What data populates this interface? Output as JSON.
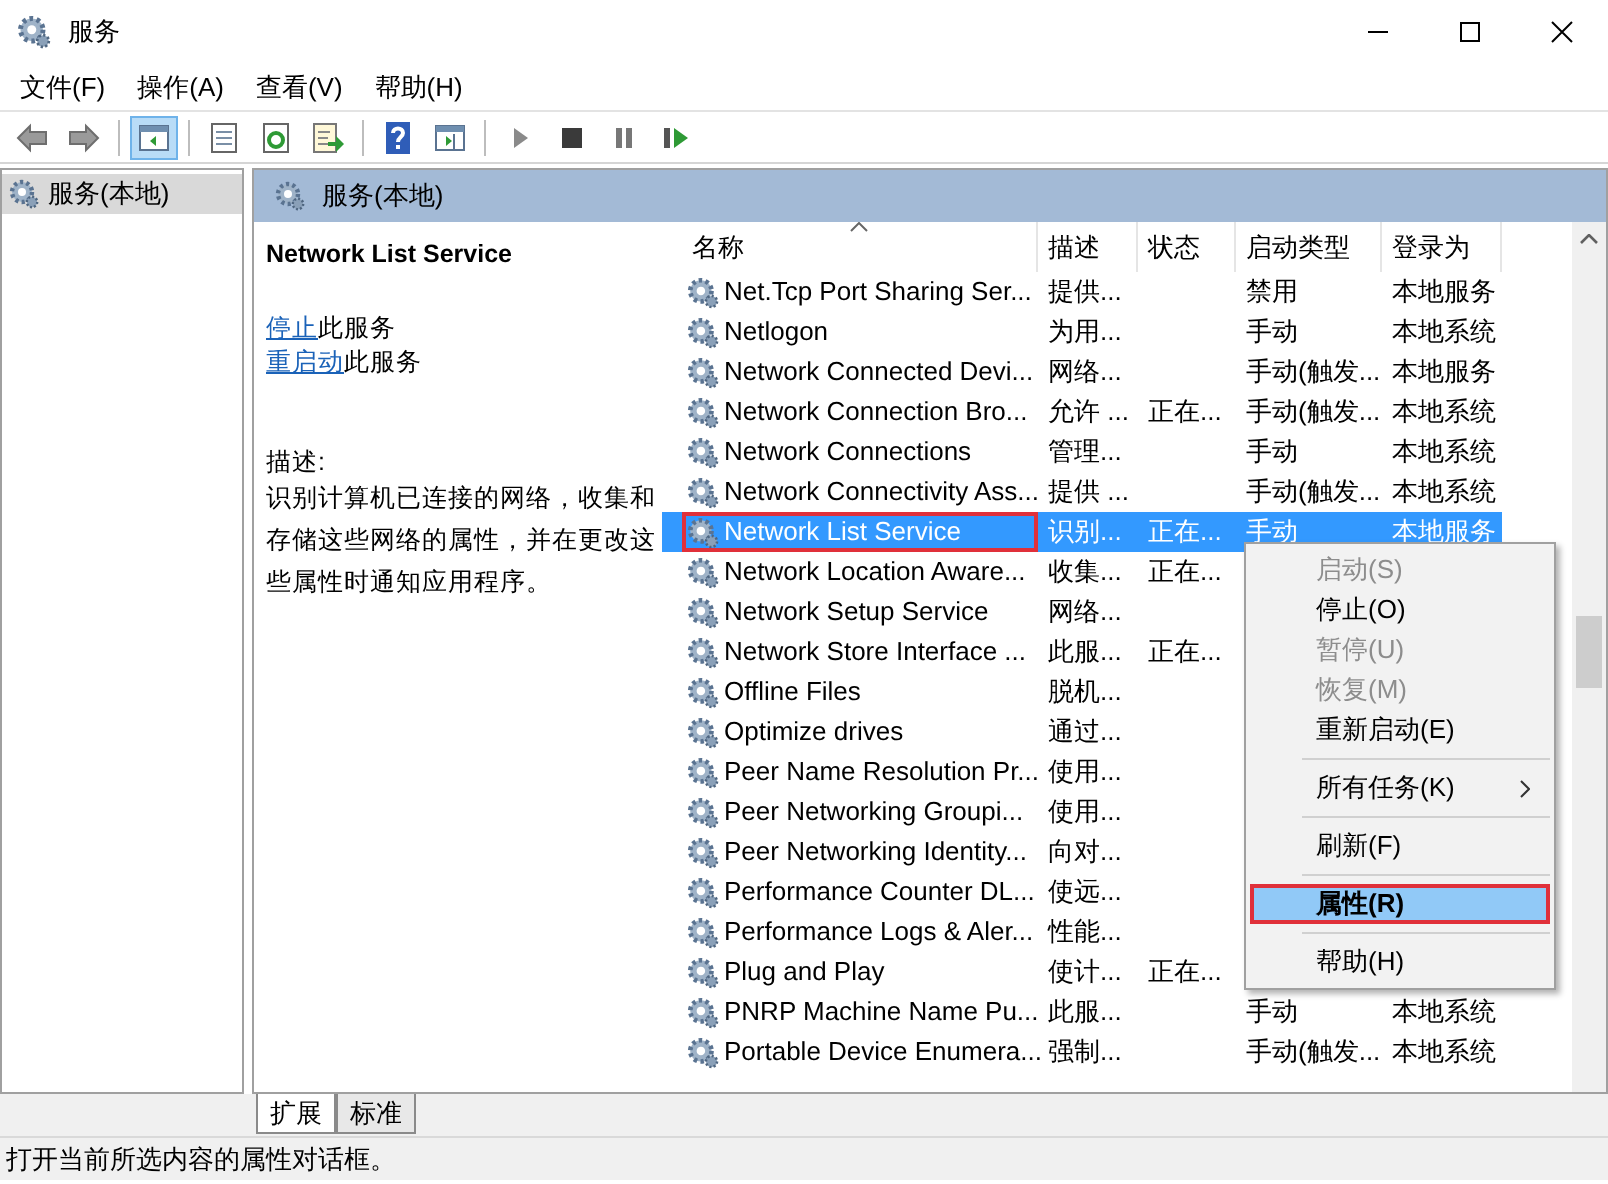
{
  "window": {
    "title": "服务"
  },
  "menu": [
    "文件(F)",
    "操作(A)",
    "查看(V)",
    "帮助(H)"
  ],
  "toolbar": [
    {
      "kind": "back",
      "pressed": false
    },
    {
      "kind": "forward",
      "pressed": false
    },
    {
      "kind": "separator"
    },
    {
      "kind": "tree",
      "pressed": true
    },
    {
      "kind": "separator"
    },
    {
      "kind": "properties",
      "pressed": false
    },
    {
      "kind": "refresh",
      "pressed": false
    },
    {
      "kind": "export",
      "pressed": false
    },
    {
      "kind": "separator"
    },
    {
      "kind": "help",
      "pressed": false
    },
    {
      "kind": "pane",
      "pressed": false
    },
    {
      "kind": "separator"
    },
    {
      "kind": "start",
      "pressed": false
    },
    {
      "kind": "stop",
      "pressed": false
    },
    {
      "kind": "pause",
      "pressed": false
    },
    {
      "kind": "resume",
      "pressed": false
    }
  ],
  "tree": [
    {
      "label": "服务(本地)",
      "selected": true
    }
  ],
  "panel_header": "服务(本地)",
  "details": {
    "title": "Network List Service",
    "links": [
      {
        "link": "停止",
        "text": "此服务"
      },
      {
        "link": "重启动",
        "text": "此服务"
      }
    ],
    "description_label": "描述:",
    "description": "识别计算机已连接的网络，收集和存储这些网络的属性，并在更改这些属性时通知应用程序。"
  },
  "table": {
    "columns": [
      {
        "label": "名称",
        "sorted": true
      },
      {
        "label": "描述",
        "sorted": false
      },
      {
        "label": "状态",
        "sorted": false
      },
      {
        "label": "启动类型",
        "sorted": false
      },
      {
        "label": "登录为",
        "sorted": false
      }
    ],
    "rows": [
      {
        "name": "Net.Tcp Port Sharing Ser...",
        "description": "提供...",
        "status": "",
        "startup": "禁用",
        "logon": "本地服务",
        "selected": false,
        "annotated": false
      },
      {
        "name": "Netlogon",
        "description": "为用...",
        "status": "",
        "startup": "手动",
        "logon": "本地系统",
        "selected": false,
        "annotated": false
      },
      {
        "name": "Network Connected Devi...",
        "description": "网络...",
        "status": "",
        "startup": "手动(触发...",
        "logon": "本地服务",
        "selected": false,
        "annotated": false
      },
      {
        "name": "Network Connection Bro...",
        "description": "允许 ...",
        "status": "正在...",
        "startup": "手动(触发...",
        "logon": "本地系统",
        "selected": false,
        "annotated": false
      },
      {
        "name": "Network Connections",
        "description": "管理...",
        "status": "",
        "startup": "手动",
        "logon": "本地系统",
        "selected": false,
        "annotated": false
      },
      {
        "name": "Network Connectivity Ass...",
        "description": "提供 ...",
        "status": "",
        "startup": "手动(触发...",
        "logon": "本地系统",
        "selected": false,
        "annotated": false
      },
      {
        "name": "Network List Service",
        "description": "识别...",
        "status": "正在...",
        "startup": "手动",
        "logon": "本地服务",
        "selected": true,
        "annotated": true
      },
      {
        "name": "Network Location Aware...",
        "description": "收集...",
        "status": "正在...",
        "selected": false,
        "annotated": false
      },
      {
        "name": "Network Setup Service",
        "description": "网络...",
        "status": "",
        "selected": false,
        "annotated": false
      },
      {
        "name": "Network Store Interface ...",
        "description": "此服...",
        "status": "正在...",
        "selected": false,
        "annotated": false
      },
      {
        "name": "Offline Files",
        "description": "脱机...",
        "status": "",
        "selected": false,
        "annotated": false
      },
      {
        "name": "Optimize drives",
        "description": "通过...",
        "status": "",
        "selected": false,
        "annotated": false
      },
      {
        "name": "Peer Name Resolution Pr...",
        "description": "使用...",
        "status": "",
        "selected": false,
        "annotated": false
      },
      {
        "name": "Peer Networking Groupi...",
        "description": "使用...",
        "status": "",
        "selected": false,
        "annotated": false
      },
      {
        "name": "Peer Networking Identity...",
        "description": "向对...",
        "status": "",
        "selected": false,
        "annotated": false
      },
      {
        "name": "Performance Counter DL...",
        "description": "使远...",
        "status": "",
        "selected": false,
        "annotated": false
      },
      {
        "name": "Performance Logs & Aler...",
        "description": "性能...",
        "status": "",
        "selected": false,
        "annotated": false
      },
      {
        "name": "Plug and Play",
        "description": "使计...",
        "status": "正在...",
        "selected": false,
        "annotated": false
      },
      {
        "name": "PNRP Machine Name Pu...",
        "description": "此服...",
        "status": "",
        "startup": "手动",
        "logon": "本地系统",
        "selected": false,
        "annotated": false
      },
      {
        "name": "Portable Device Enumera...",
        "description": "强制...",
        "status": "",
        "startup": "手动(触发...",
        "logon": "本地系统",
        "selected": false,
        "annotated": false
      }
    ]
  },
  "context_menu": [
    {
      "kind": "item",
      "label": "启动(S)",
      "disabled": true,
      "selected": false,
      "default": false,
      "annotated": false
    },
    {
      "kind": "item",
      "label": "停止(O)",
      "disabled": false,
      "selected": false,
      "default": false,
      "annotated": false
    },
    {
      "kind": "item",
      "label": "暂停(U)",
      "disabled": true,
      "selected": false,
      "default": false,
      "annotated": false
    },
    {
      "kind": "item",
      "label": "恢复(M)",
      "disabled": true,
      "selected": false,
      "default": false,
      "annotated": false
    },
    {
      "kind": "item",
      "label": "重新启动(E)",
      "disabled": false,
      "selected": false,
      "default": false,
      "annotated": false
    },
    {
      "kind": "separator"
    },
    {
      "kind": "submenu",
      "label": "所有任务(K)",
      "disabled": false,
      "selected": false,
      "default": false,
      "annotated": false
    },
    {
      "kind": "separator"
    },
    {
      "kind": "item",
      "label": "刷新(F)",
      "disabled": false,
      "selected": false,
      "default": false,
      "annotated": false
    },
    {
      "kind": "separator"
    },
    {
      "kind": "item",
      "label": "属性(R)",
      "disabled": false,
      "selected": true,
      "default": true,
      "annotated": true
    },
    {
      "kind": "separator"
    },
    {
      "kind": "item",
      "label": "帮助(H)",
      "disabled": false,
      "selected": false,
      "default": false,
      "annotated": false
    }
  ],
  "tabs": [
    {
      "label": "扩展",
      "selected": true
    },
    {
      "label": "标准",
      "selected": false
    }
  ],
  "status_bar": "打开当前所选内容的属性对话框。"
}
